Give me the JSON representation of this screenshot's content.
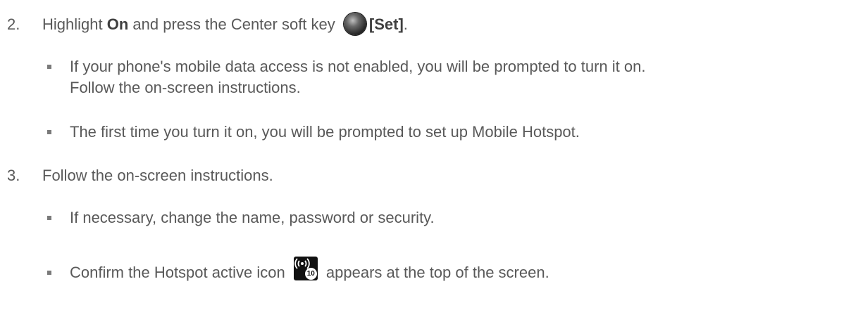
{
  "steps": [
    {
      "number": "2.",
      "text_before": "Highlight ",
      "bold1": "On",
      "text_middle": " and press the Center soft key ",
      "bold2": "[Set]",
      "text_after": ".",
      "bullets": [
        {
          "line1": "If your phone's mobile data access is not enabled, you will be prompted to turn it on.",
          "line2": "Follow the on-screen instructions."
        },
        {
          "line1": "The first time you turn it on, you will be prompted to set up Mobile Hotspot."
        }
      ]
    },
    {
      "number": "3.",
      "text": "Follow the on-screen instructions.",
      "bullets": [
        {
          "line1": "If necessary, change the name, password or security."
        },
        {
          "before": "Confirm the Hotspot active icon ",
          "after": " appears at the top of the screen.",
          "icon_badge": "10"
        }
      ]
    }
  ],
  "icons": {
    "center_key": "center-soft-key-icon",
    "hotspot": "hotspot-active-icon"
  }
}
